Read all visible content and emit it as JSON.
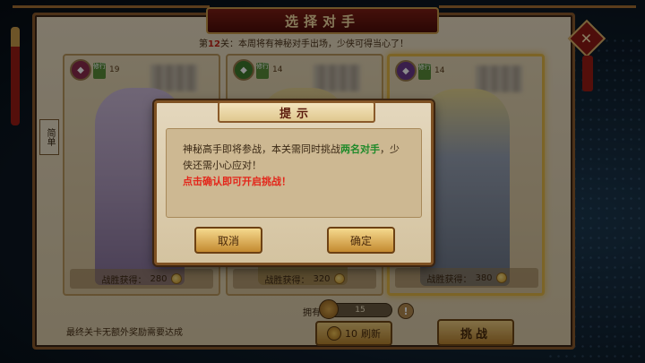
{
  "header": {
    "title": "选择对手",
    "close_label": "✕"
  },
  "stage_info": {
    "prefix": "第",
    "stage_number": "12",
    "suffix": "关：本周将有神秘对手出场，少侠可得当心了！"
  },
  "difficulty_tag": "简单",
  "opponents": [
    {
      "level": "19",
      "badge": "修行",
      "reward_label": "战胜获得：",
      "reward_value": "280",
      "emblem_color": "#8a2d4e",
      "figure_color": "#b7a6c8"
    },
    {
      "level": "14",
      "badge": "修行",
      "reward_label": "战胜获得：",
      "reward_value": "320",
      "emblem_color": "#3e7a2c",
      "figure_color": "#d9c27e"
    },
    {
      "level": "14",
      "badge": "修行",
      "reward_label": "战胜获得：",
      "reward_value": "380",
      "emblem_color": "#6a3a8a",
      "figure_color": "#9aa7bf"
    }
  ],
  "footer": {
    "note": "最终关卡无额外奖励需要达成",
    "own_label": "拥有",
    "own_value": "15",
    "info_label": "!",
    "refresh_cost": "10",
    "refresh_label": "刷新",
    "challenge_label": "挑战"
  },
  "modal": {
    "title": "提示",
    "line1": "神秘高手即将参战，本关需同时挑战",
    "highlight": "两名对手",
    "line2": "，少侠还需小心应对！",
    "warning": "点击确认即可开启挑战！",
    "cancel_label": "取消",
    "confirm_label": "确定"
  }
}
